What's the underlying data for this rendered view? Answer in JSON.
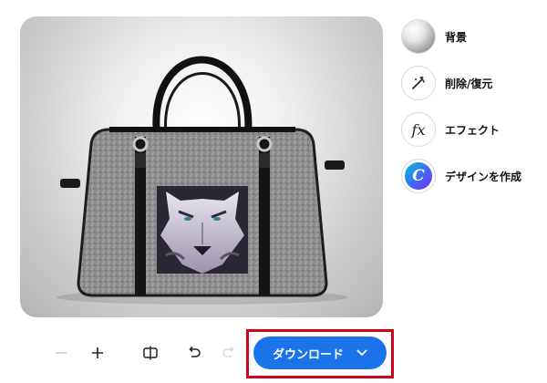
{
  "preview": {
    "image_subject": "gray felt handbag with embroidered wolf face"
  },
  "tools": [
    {
      "id": "background",
      "label": "背景",
      "icon": "gradient-sphere-icon"
    },
    {
      "id": "erase-restore",
      "label": "削除/復元",
      "icon": "magic-wand-icon"
    },
    {
      "id": "effects",
      "label": "エフェクト",
      "icon": "fx-icon"
    },
    {
      "id": "design",
      "label": "デザインを作成",
      "icon": "canva-logo-icon"
    }
  ],
  "toolbar": {
    "zoom_out_icon": "minus-icon",
    "zoom_in_icon": "plus-icon",
    "compare_icon": "compare-icon",
    "undo_icon": "undo-icon",
    "redo_icon": "redo-icon",
    "download_label": "ダウンロード",
    "download_icon": "chevron-down-icon"
  },
  "colors": {
    "download_button": "#1a73e8",
    "highlight_box": "#d0021b",
    "canva_gradient": [
      "#00c4cc",
      "#7d2ae8"
    ]
  }
}
